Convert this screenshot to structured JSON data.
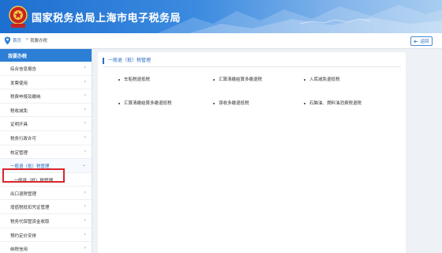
{
  "header": {
    "title": "国家税务总局上海市电子税务局",
    "emblem_icon": "tax-emblem-icon"
  },
  "breadcrumb": {
    "home": "首页",
    "separator": ">",
    "current": "我要办税"
  },
  "back_button": {
    "label": "返回",
    "icon": "back-arrow-icon"
  },
  "sidebar": {
    "header": "我要办税",
    "items": [
      {
        "label": "综合信息报告"
      },
      {
        "label": "发票使用"
      },
      {
        "label": "税费申报及缴纳"
      },
      {
        "label": "税收减免"
      },
      {
        "label": "证明开具"
      },
      {
        "label": "税务行政许可"
      },
      {
        "label": "核定管理"
      },
      {
        "label": "一般退（抵）税管理",
        "expanded": true
      },
      {
        "label": "出口退税管理"
      },
      {
        "label": "增值税抵扣凭证管理"
      },
      {
        "label": "税务代保管资金收取"
      },
      {
        "label": "预约定价安排"
      },
      {
        "label": "纳税信用"
      }
    ],
    "sub_item": {
      "label": "一般退（抵）税管理"
    }
  },
  "main": {
    "section_title": "一般退（抵）税管理",
    "links": [
      {
        "label": "车船税退抵税"
      },
      {
        "label": "汇算清缴结算多缴退税"
      },
      {
        "label": "入库减免退抵税"
      },
      {
        "label": "汇算清缴结算多缴退抵税"
      },
      {
        "label": "误收多缴退抵税"
      },
      {
        "label": "石脑油、燃料油消费税退税"
      }
    ]
  },
  "colors": {
    "accent": "#2d7fd6",
    "highlight": "#d9262c",
    "header_blue": "#1d6fd0"
  }
}
